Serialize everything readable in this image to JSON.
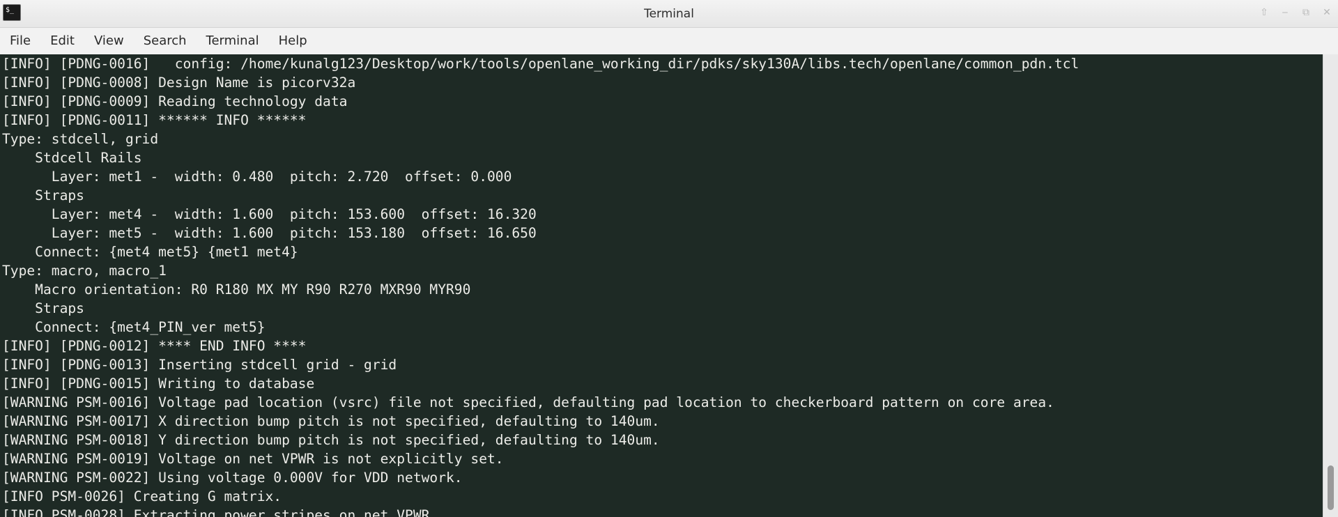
{
  "window": {
    "title": "Terminal",
    "app_icon_glyph": "$_",
    "controls": {
      "up_glyph": "⇧",
      "minimize_glyph": "‒",
      "maximize_glyph": "⧉",
      "close_glyph": "✕"
    }
  },
  "menubar": {
    "items": [
      "File",
      "Edit",
      "View",
      "Search",
      "Terminal",
      "Help"
    ]
  },
  "terminal": {
    "colors": {
      "background": "#1e2a25",
      "text": "#ecece8"
    },
    "lines": [
      "[INFO] [PDNG-0016]   config: /home/kunalg123/Desktop/work/tools/openlane_working_dir/pdks/sky130A/libs.tech/openlane/common_pdn.tcl",
      "[INFO] [PDNG-0008] Design Name is picorv32a",
      "[INFO] [PDNG-0009] Reading technology data",
      "[INFO] [PDNG-0011] ****** INFO ******",
      "Type: stdcell, grid",
      "    Stdcell Rails",
      "      Layer: met1 -  width: 0.480  pitch: 2.720  offset: 0.000",
      "    Straps",
      "      Layer: met4 -  width: 1.600  pitch: 153.600  offset: 16.320",
      "      Layer: met5 -  width: 1.600  pitch: 153.180  offset: 16.650",
      "    Connect: {met4 met5} {met1 met4}",
      "Type: macro, macro_1",
      "    Macro orientation: R0 R180 MX MY R90 R270 MXR90 MYR90",
      "    Straps",
      "    Connect: {met4_PIN_ver met5}",
      "[INFO] [PDNG-0012] **** END INFO ****",
      "[INFO] [PDNG-0013] Inserting stdcell grid - grid",
      "[INFO] [PDNG-0015] Writing to database",
      "[WARNING PSM-0016] Voltage pad location (vsrc) file not specified, defaulting pad location to checkerboard pattern on core area.",
      "[WARNING PSM-0017] X direction bump pitch is not specified, defaulting to 140um.",
      "[WARNING PSM-0018] Y direction bump pitch is not specified, defaulting to 140um.",
      "[WARNING PSM-0019] Voltage on net VPWR is not explicitly set.",
      "[WARNING PSM-0022] Using voltage 0.000V for VDD network.",
      "[INFO PSM-0026] Creating G matrix.",
      "[INFO PSM-0028] Extracting power stripes on net VPWR"
    ]
  }
}
